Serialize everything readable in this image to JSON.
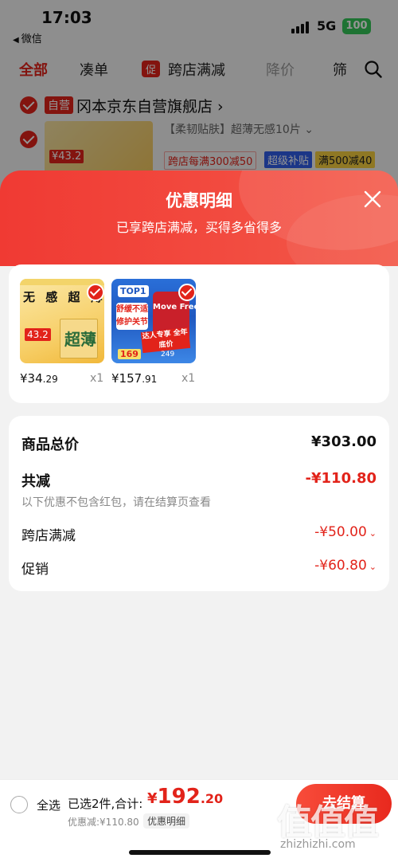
{
  "status_bar": {
    "time": "17:03",
    "back_app": "微信",
    "network": "5G",
    "battery": "100"
  },
  "background": {
    "tabs": [
      "全部",
      "凑单",
      "跨店满减",
      "降价",
      "筛"
    ],
    "promo_tag": "促",
    "store": {
      "badge": "自营",
      "name": "冈本京东自营旗舰店 ›"
    },
    "product_title": "【柔韧贴肤】超薄无感10片 ⌄",
    "tags": [
      "跨店每满300减50",
      "超级补贴",
      "满500减40"
    ],
    "thumb_price": "¥43.2"
  },
  "sheet": {
    "title": "优惠明细",
    "subtitle": "已享跨店满减，买得多省得多",
    "goods": [
      {
        "name": "冈本超薄",
        "img_text": "无 感 超 薄",
        "price_int": "¥34",
        "price_dec": ".29",
        "qty": "x1",
        "thumb_price": "43.2",
        "thumb_brand": "超薄"
      },
      {
        "name": "Move Free",
        "img_text": "TOP1",
        "price_int": "¥157",
        "price_dec": ".91",
        "qty": "x1",
        "thumb_price": "169",
        "thumb_price2": "249",
        "thumb_brand": "Move Free",
        "thumb_slogan": "舒缓不适 修护关节",
        "thumb_banner": "达人专享 全年底价"
      }
    ],
    "summary": {
      "total_label": "商品总价",
      "total_value": "¥303.00",
      "discount_label": "共减",
      "discount_value": "-¥110.80",
      "hint": "以下优惠不包含红包，请在结算页查看",
      "items": [
        {
          "label": "跨店满减",
          "value": "-¥50.00"
        },
        {
          "label": "促销",
          "value": "-¥60.80"
        }
      ]
    }
  },
  "bottom_bar": {
    "select_all": "全选",
    "selected_text": "已选2件,合计:",
    "total_yen": "¥",
    "total_int": "192",
    "total_dec": ".20",
    "discount_text": "优惠减:¥110.80",
    "detail_link": "优惠明细",
    "checkout": "去结算"
  },
  "watermark": {
    "cn": "值值值",
    "en": "zhizhizhi.com"
  },
  "colors": {
    "accent": "#e2231a",
    "header_start": "#f03a33",
    "header_end": "#f35a4a"
  }
}
